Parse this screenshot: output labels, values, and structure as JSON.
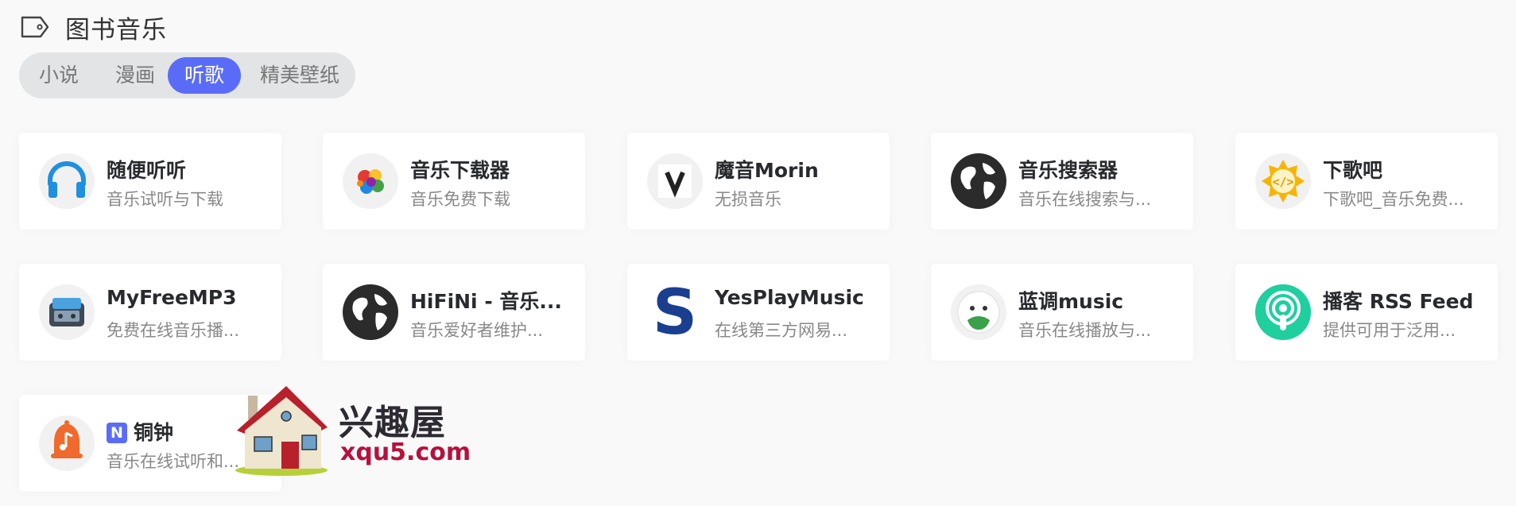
{
  "section": {
    "icon": "tag-icon",
    "title": "图书音乐"
  },
  "tabs": [
    {
      "label": "小说",
      "active": false
    },
    {
      "label": "漫画",
      "active": false
    },
    {
      "label": "听歌",
      "active": true
    },
    {
      "label": "精美壁纸",
      "active": false
    }
  ],
  "colors": {
    "accent": "#5a6cf7",
    "background": "#f9f9f9",
    "card": "#ffffff",
    "muted_text": "#888888"
  },
  "cards": [
    {
      "name": "随便听听",
      "desc": "音乐试听与下载",
      "icon": "headphones-icon"
    },
    {
      "name": "音乐下载器",
      "desc": "音乐免费下载",
      "icon": "colorful-splash-icon"
    },
    {
      "name": "魔音Morin",
      "desc": "无损音乐",
      "icon": "v-letter-icon"
    },
    {
      "name": "音乐搜索器",
      "desc": "音乐在线搜索与...",
      "icon": "globe-icon"
    },
    {
      "name": "下歌吧",
      "desc": "下歌吧_音乐免费...",
      "icon": "code-sun-icon"
    },
    {
      "name": "MyFreeMP3",
      "desc": "免费在线音乐播...",
      "icon": "music-box-icon"
    },
    {
      "name": "HiFiNi - 音乐...",
      "desc": "音乐爱好者维护...",
      "icon": "globe-icon"
    },
    {
      "name": "YesPlayMusic",
      "desc": "在线第三方网易...",
      "icon": "s-letter-icon"
    },
    {
      "name": "蓝调music",
      "desc": "音乐在线播放与...",
      "icon": "smiley-face-icon"
    },
    {
      "name": "播客 RSS Feed",
      "desc": "提供可用于泛用...",
      "icon": "podcast-icon"
    },
    {
      "name": "铜钟",
      "badge": "N",
      "desc": "音乐在线试听和...",
      "icon": "bell-note-icon"
    }
  ],
  "watermark": {
    "title": "兴趣屋",
    "subtitle": "xqu5.com"
  }
}
